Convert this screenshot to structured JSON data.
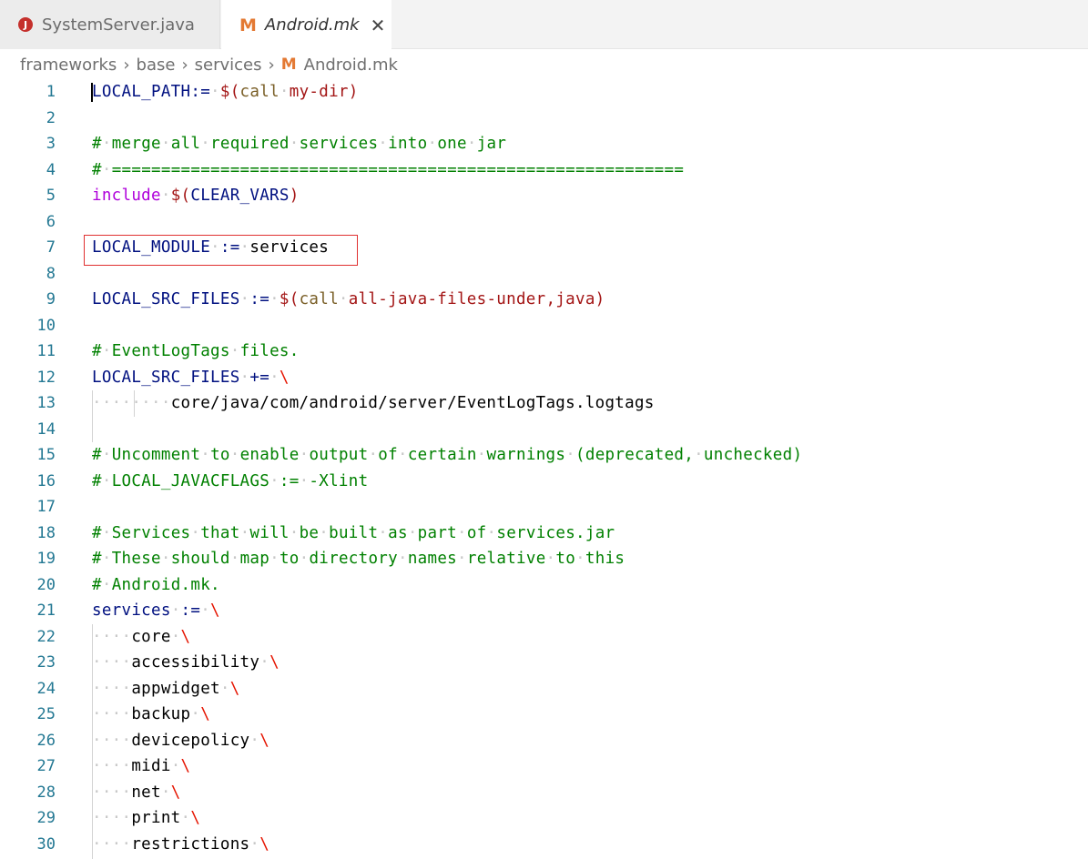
{
  "tabs": [
    {
      "label": "SystemServer.java",
      "icon": "java-icon",
      "active": false
    },
    {
      "label": "Android.mk",
      "icon": "makefile-icon",
      "active": true
    }
  ],
  "breadcrumb": [
    "frameworks",
    "base",
    "services",
    "Android.mk"
  ],
  "lines": [
    {
      "n": "1",
      "tokens": [
        [
          "var",
          "LOCAL_PATH:="
        ],
        [
          "ws",
          "·"
        ],
        [
          "str",
          "$("
        ],
        [
          "fn",
          "call"
        ],
        [
          "ws",
          "·"
        ],
        [
          "str",
          "my-dir)"
        ]
      ]
    },
    {
      "n": "2",
      "tokens": []
    },
    {
      "n": "3",
      "tokens": [
        [
          "cmt",
          "#"
        ],
        [
          "ws",
          "·"
        ],
        [
          "cmt",
          "merge"
        ],
        [
          "ws",
          "·"
        ],
        [
          "cmt",
          "all"
        ],
        [
          "ws",
          "·"
        ],
        [
          "cmt",
          "required"
        ],
        [
          "ws",
          "·"
        ],
        [
          "cmt",
          "services"
        ],
        [
          "ws",
          "·"
        ],
        [
          "cmt",
          "into"
        ],
        [
          "ws",
          "·"
        ],
        [
          "cmt",
          "one"
        ],
        [
          "ws",
          "·"
        ],
        [
          "cmt",
          "jar"
        ]
      ]
    },
    {
      "n": "4",
      "tokens": [
        [
          "cmt",
          "#"
        ],
        [
          "ws",
          "·"
        ],
        [
          "cmt",
          "=========================================================="
        ]
      ]
    },
    {
      "n": "5",
      "tokens": [
        [
          "kw",
          "include"
        ],
        [
          "ws",
          "·"
        ],
        [
          "str",
          "$("
        ],
        [
          "var",
          "CLEAR_VARS"
        ],
        [
          "str",
          ")"
        ]
      ]
    },
    {
      "n": "6",
      "tokens": []
    },
    {
      "n": "7",
      "tokens": [
        [
          "var",
          "LOCAL_MODULE"
        ],
        [
          "ws",
          "·"
        ],
        [
          "var",
          ":="
        ],
        [
          "ws",
          "·"
        ],
        [
          "plain",
          "services"
        ]
      ]
    },
    {
      "n": "8",
      "tokens": []
    },
    {
      "n": "9",
      "tokens": [
        [
          "var",
          "LOCAL_SRC_FILES"
        ],
        [
          "ws",
          "·"
        ],
        [
          "var",
          ":="
        ],
        [
          "ws",
          "·"
        ],
        [
          "str",
          "$("
        ],
        [
          "fn",
          "call"
        ],
        [
          "ws",
          "·"
        ],
        [
          "str",
          "all-java-files-under,java)"
        ]
      ]
    },
    {
      "n": "10",
      "tokens": []
    },
    {
      "n": "11",
      "tokens": [
        [
          "cmt",
          "#"
        ],
        [
          "ws",
          "·"
        ],
        [
          "cmt",
          "EventLogTags"
        ],
        [
          "ws",
          "·"
        ],
        [
          "cmt",
          "files."
        ]
      ]
    },
    {
      "n": "12",
      "tokens": [
        [
          "var",
          "LOCAL_SRC_FILES"
        ],
        [
          "ws",
          "·"
        ],
        [
          "var",
          "+="
        ],
        [
          "ws",
          "·"
        ],
        [
          "bs",
          "\\"
        ]
      ]
    },
    {
      "n": "13",
      "tokens": [
        [
          "ws",
          "····"
        ],
        [
          "ws",
          "····"
        ],
        [
          "plain",
          "core/java/com/android/server/EventLogTags.logtags"
        ]
      ]
    },
    {
      "n": "14",
      "tokens": []
    },
    {
      "n": "15",
      "tokens": [
        [
          "cmt",
          "#"
        ],
        [
          "ws",
          "·"
        ],
        [
          "cmt",
          "Uncomment"
        ],
        [
          "ws",
          "·"
        ],
        [
          "cmt",
          "to"
        ],
        [
          "ws",
          "·"
        ],
        [
          "cmt",
          "enable"
        ],
        [
          "ws",
          "·"
        ],
        [
          "cmt",
          "output"
        ],
        [
          "ws",
          "·"
        ],
        [
          "cmt",
          "of"
        ],
        [
          "ws",
          "·"
        ],
        [
          "cmt",
          "certain"
        ],
        [
          "ws",
          "·"
        ],
        [
          "cmt",
          "warnings"
        ],
        [
          "ws",
          "·"
        ],
        [
          "cmt",
          "(deprecated,"
        ],
        [
          "ws",
          "·"
        ],
        [
          "cmt",
          "unchecked)"
        ]
      ]
    },
    {
      "n": "16",
      "tokens": [
        [
          "cmt",
          "#"
        ],
        [
          "ws",
          "·"
        ],
        [
          "cmt",
          "LOCAL_JAVACFLAGS"
        ],
        [
          "ws",
          "·"
        ],
        [
          "cmt",
          ":="
        ],
        [
          "ws",
          "·"
        ],
        [
          "cmt",
          "-Xlint"
        ]
      ]
    },
    {
      "n": "17",
      "tokens": []
    },
    {
      "n": "18",
      "tokens": [
        [
          "cmt",
          "#"
        ],
        [
          "ws",
          "·"
        ],
        [
          "cmt",
          "Services"
        ],
        [
          "ws",
          "·"
        ],
        [
          "cmt",
          "that"
        ],
        [
          "ws",
          "·"
        ],
        [
          "cmt",
          "will"
        ],
        [
          "ws",
          "·"
        ],
        [
          "cmt",
          "be"
        ],
        [
          "ws",
          "·"
        ],
        [
          "cmt",
          "built"
        ],
        [
          "ws",
          "·"
        ],
        [
          "cmt",
          "as"
        ],
        [
          "ws",
          "·"
        ],
        [
          "cmt",
          "part"
        ],
        [
          "ws",
          "·"
        ],
        [
          "cmt",
          "of"
        ],
        [
          "ws",
          "·"
        ],
        [
          "cmt",
          "services.jar"
        ]
      ]
    },
    {
      "n": "19",
      "tokens": [
        [
          "cmt",
          "#"
        ],
        [
          "ws",
          "·"
        ],
        [
          "cmt",
          "These"
        ],
        [
          "ws",
          "·"
        ],
        [
          "cmt",
          "should"
        ],
        [
          "ws",
          "·"
        ],
        [
          "cmt",
          "map"
        ],
        [
          "ws",
          "·"
        ],
        [
          "cmt",
          "to"
        ],
        [
          "ws",
          "·"
        ],
        [
          "cmt",
          "directory"
        ],
        [
          "ws",
          "·"
        ],
        [
          "cmt",
          "names"
        ],
        [
          "ws",
          "·"
        ],
        [
          "cmt",
          "relative"
        ],
        [
          "ws",
          "·"
        ],
        [
          "cmt",
          "to"
        ],
        [
          "ws",
          "·"
        ],
        [
          "cmt",
          "this"
        ]
      ]
    },
    {
      "n": "20",
      "tokens": [
        [
          "cmt",
          "#"
        ],
        [
          "ws",
          "·"
        ],
        [
          "cmt",
          "Android.mk."
        ]
      ]
    },
    {
      "n": "21",
      "tokens": [
        [
          "var",
          "services"
        ],
        [
          "ws",
          "·"
        ],
        [
          "var",
          ":="
        ],
        [
          "ws",
          "·"
        ],
        [
          "bs",
          "\\"
        ]
      ]
    },
    {
      "n": "22",
      "tokens": [
        [
          "ws",
          "····"
        ],
        [
          "plain",
          "core"
        ],
        [
          "ws",
          "·"
        ],
        [
          "bs",
          "\\"
        ]
      ]
    },
    {
      "n": "23",
      "tokens": [
        [
          "ws",
          "····"
        ],
        [
          "plain",
          "accessibility"
        ],
        [
          "ws",
          "·"
        ],
        [
          "bs",
          "\\"
        ]
      ]
    },
    {
      "n": "24",
      "tokens": [
        [
          "ws",
          "····"
        ],
        [
          "plain",
          "appwidget"
        ],
        [
          "ws",
          "·"
        ],
        [
          "bs",
          "\\"
        ]
      ]
    },
    {
      "n": "25",
      "tokens": [
        [
          "ws",
          "····"
        ],
        [
          "plain",
          "backup"
        ],
        [
          "ws",
          "·"
        ],
        [
          "bs",
          "\\"
        ]
      ]
    },
    {
      "n": "26",
      "tokens": [
        [
          "ws",
          "····"
        ],
        [
          "plain",
          "devicepolicy"
        ],
        [
          "ws",
          "·"
        ],
        [
          "bs",
          "\\"
        ]
      ]
    },
    {
      "n": "27",
      "tokens": [
        [
          "ws",
          "····"
        ],
        [
          "plain",
          "midi"
        ],
        [
          "ws",
          "·"
        ],
        [
          "bs",
          "\\"
        ]
      ]
    },
    {
      "n": "28",
      "tokens": [
        [
          "ws",
          "····"
        ],
        [
          "plain",
          "net"
        ],
        [
          "ws",
          "·"
        ],
        [
          "bs",
          "\\"
        ]
      ]
    },
    {
      "n": "29",
      "tokens": [
        [
          "ws",
          "····"
        ],
        [
          "plain",
          "print"
        ],
        [
          "ws",
          "·"
        ],
        [
          "bs",
          "\\"
        ]
      ]
    },
    {
      "n": "30",
      "tokens": [
        [
          "ws",
          "····"
        ],
        [
          "plain",
          "restrictions"
        ],
        [
          "ws",
          "·"
        ],
        [
          "bs",
          "\\"
        ]
      ]
    }
  ],
  "colors": {
    "variable": "#001080",
    "keyword": "#af00db",
    "comment": "#008000",
    "string": "#a31515",
    "function": "#795e26",
    "backslash": "#e51400",
    "line_number": "#237893",
    "highlight_box": "#e03030"
  }
}
